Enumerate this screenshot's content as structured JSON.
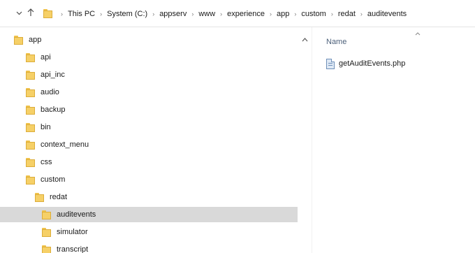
{
  "breadcrumb": {
    "parts": [
      "This PC",
      "System (C:)",
      "appserv",
      "www",
      "experience",
      "app",
      "custom",
      "redat",
      "auditevents"
    ]
  },
  "tree": {
    "items": [
      {
        "label": "app",
        "level": 0
      },
      {
        "label": "api",
        "level": 1
      },
      {
        "label": "api_inc",
        "level": 1
      },
      {
        "label": "audio",
        "level": 1
      },
      {
        "label": "backup",
        "level": 1
      },
      {
        "label": "bin",
        "level": 1
      },
      {
        "label": "context_menu",
        "level": 1
      },
      {
        "label": "css",
        "level": 1
      },
      {
        "label": "custom",
        "level": 1
      },
      {
        "label": "redat",
        "level": 2
      },
      {
        "label": "auditevents",
        "level": 3,
        "selected": true
      },
      {
        "label": "simulator",
        "level": 3
      },
      {
        "label": "transcript",
        "level": 3
      }
    ]
  },
  "files": {
    "column_header": "Name",
    "items": [
      {
        "name": "getAuditEvents.php"
      }
    ]
  },
  "icons": {
    "back": "chevron-down-icon",
    "up": "up-arrow-icon",
    "folder": "folder-icon",
    "file": "php-file-icon",
    "scroll_up": "scroll-up-arrow-icon",
    "sort": "sort-ascending-icon"
  },
  "colors": {
    "selection": "#d9d9d9",
    "folder": "#f6d067",
    "header_text": "#4c607a"
  }
}
